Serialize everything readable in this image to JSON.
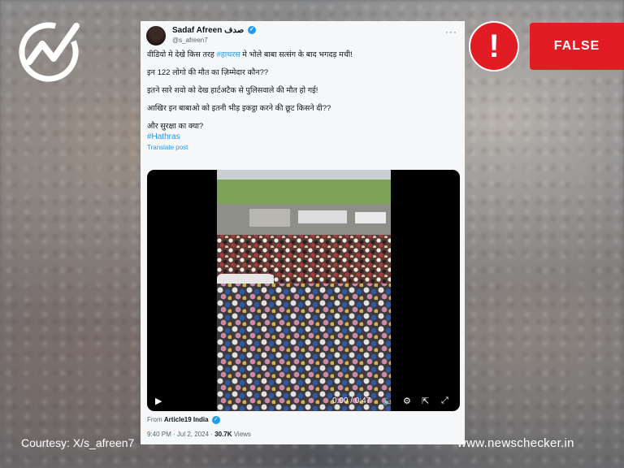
{
  "brand": {
    "site_url": "www.newschecker.in",
    "verdict": "FALSE",
    "alert_symbol": "!",
    "accent_color": "#e11c24"
  },
  "courtesy": "Courtesy: X/s_afreen7",
  "tweet": {
    "display_name": "Sadaf Afreen صدف",
    "handle": "@s_afreen7",
    "more_label": "···",
    "line1_pre": "वीडियो मे देखे किस तरह ",
    "line1_hashtag": "#हाथरस",
    "line1_post": " मे भोले बाबा सत्संग के बाद भगदड़ मची!",
    "line2": "इन 122 लोगो की मौत का ज़िम्मेदार कौन??",
    "line3": "इतने सारे शवो को देख हार्टअटैक से पुलिसवाले की मौत हो गई!",
    "line4": "आखिर इन बाबाओ को इतनी भीड़ इकट्ठा करने की छूट किसने दी??",
    "line5": "और सुरक्षा का क्या?",
    "hashtag": "#Hathras",
    "translate": "Translate post",
    "video": {
      "time": "0:00 / 0:47",
      "play_icon": "▶"
    },
    "from_label": "From",
    "from_account": "Article19 India",
    "timestamp": "9:40 PM · Jul 2, 2024 · ",
    "views_count": "30.7K",
    "views_label": " Views"
  }
}
